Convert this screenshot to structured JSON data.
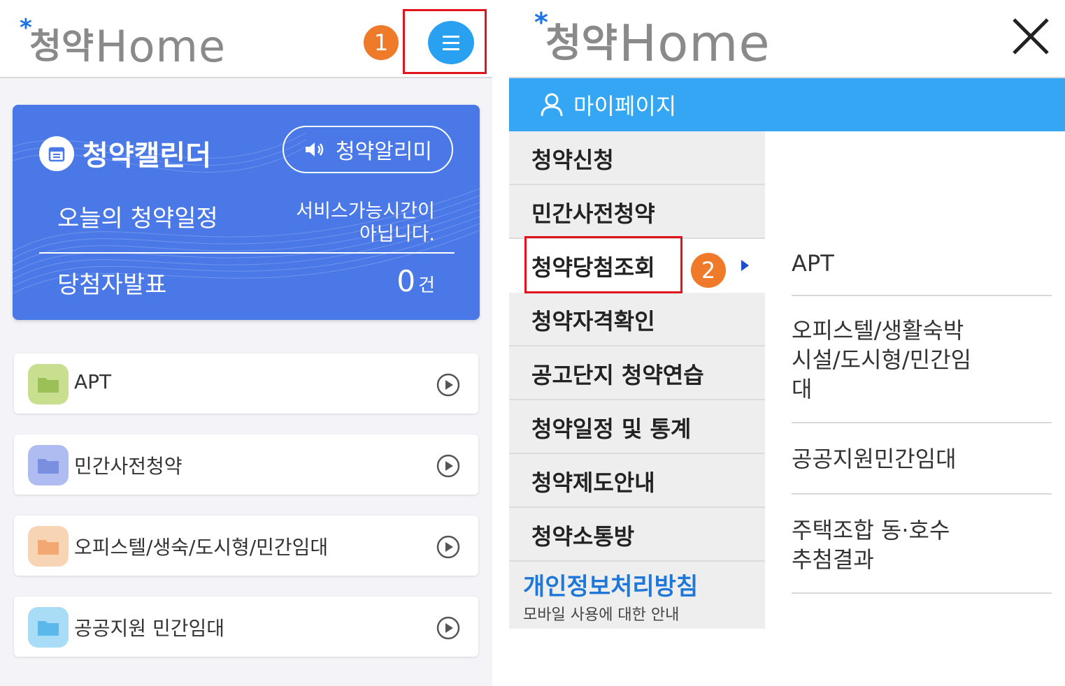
{
  "left": {
    "logo": {
      "star": "*",
      "korean": "청약",
      "home": "Home"
    },
    "badge_1": "1",
    "menu_icon": "hamburger-icon",
    "calendar": {
      "icon": "calendar-icon",
      "title": "청약캘린더",
      "alarm_button": "청약알리미",
      "alarm_icon": "speaker-icon",
      "today_label": "오늘의 청약일정",
      "today_status_line1": "서비스가능시간이",
      "today_status_line2": "아닙니다.",
      "winner_label": "당첨자발표",
      "winner_count": "0",
      "winner_unit": "건"
    },
    "list": [
      {
        "label": "APT",
        "color": "#c7df8f",
        "icon_color": "#9cc058"
      },
      {
        "label": "민간사전청약",
        "color": "#aebcf2",
        "icon_color": "#7b8fe0"
      },
      {
        "label": "오피스텔/생숙/도시형/민간임대",
        "color": "#f7d4b4",
        "icon_color": "#f1a873"
      },
      {
        "label": "공공지원 민간임대",
        "color": "#a9dcf7",
        "icon_color": "#5bb8ea"
      }
    ]
  },
  "right": {
    "logo": {
      "star": "*",
      "korean": "청약",
      "home": "Home"
    },
    "close_icon": "close-icon",
    "mypage": "마이페이지",
    "badge_2": "2",
    "side_menu": [
      {
        "label": "청약신청"
      },
      {
        "label": "민간사전청약"
      },
      {
        "label": "청약당첨조회"
      },
      {
        "label": "청약자격확인"
      },
      {
        "label": "공고단지 청약연습"
      },
      {
        "label": "청약일정 및 통계"
      },
      {
        "label": "청약제도안내"
      },
      {
        "label": "청약소통방"
      }
    ],
    "privacy": {
      "title": "개인정보처리방침",
      "sub": "모바일 사용에 대한 안내"
    },
    "sub_menu": [
      {
        "line1": "APT"
      },
      {
        "line1": "오피스텔/생활숙박",
        "line2": "시설/도시형/민간임",
        "line3": "대"
      },
      {
        "line1": "공공지원민간임대"
      },
      {
        "line1": "주택조합 동·호수",
        "line2": "추첨결과"
      }
    ]
  },
  "colors": {
    "accent_blue": "#34a6f4",
    "card_blue": "#4a78e6",
    "badge_orange": "#ee7a2a",
    "highlight_red": "#e0141b"
  }
}
